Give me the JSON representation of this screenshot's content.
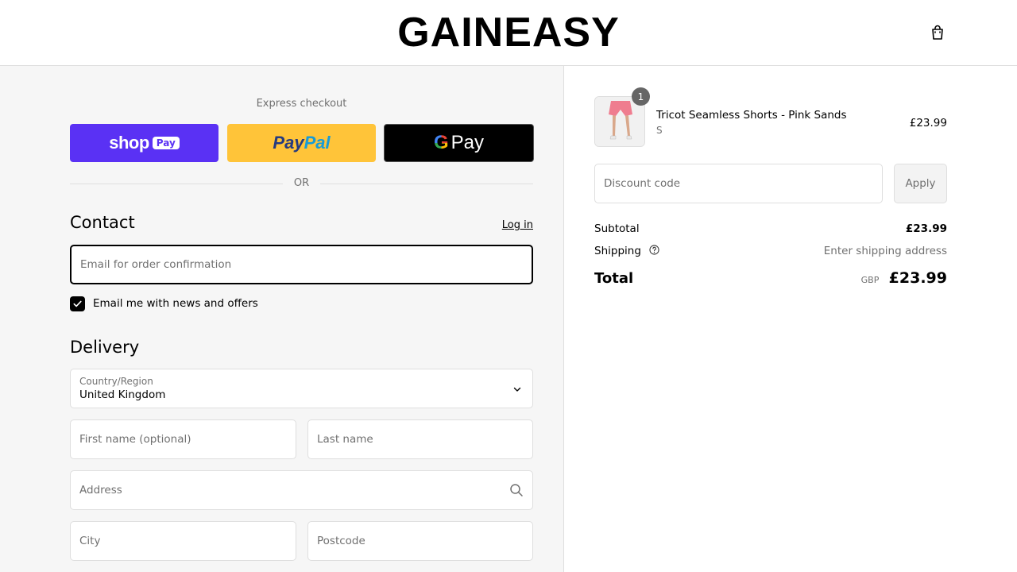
{
  "header": {
    "brand": "GAINEASY",
    "cart_icon": "shopping-bag-icon"
  },
  "express": {
    "label": "Express checkout",
    "shop_pay": {
      "word": "shop",
      "badge": "Pay"
    },
    "paypal": {
      "part1": "Pay",
      "part2": "Pal"
    },
    "gpay": {
      "g": "G",
      "word": "Pay"
    },
    "or": "OR"
  },
  "contact": {
    "title": "Contact",
    "login": "Log in",
    "email_placeholder": "Email for order confirmation",
    "newsletter_label": "Email me with news and offers",
    "newsletter_checked": true
  },
  "delivery": {
    "title": "Delivery",
    "country_label": "Country/Region",
    "country_value": "United Kingdom",
    "first_name_placeholder": "First name (optional)",
    "last_name_placeholder": "Last name",
    "address_placeholder": "Address",
    "city_placeholder": "City",
    "postcode_placeholder": "Postcode"
  },
  "order": {
    "item": {
      "name": "Tricot Seamless Shorts - Pink Sands",
      "variant": "S",
      "price": "£23.99",
      "quantity": "1"
    },
    "discount_placeholder": "Discount code",
    "apply": "Apply",
    "subtotal_label": "Subtotal",
    "subtotal_value": "£23.99",
    "shipping_label": "Shipping",
    "shipping_value": "Enter shipping address",
    "total_label": "Total",
    "currency": "GBP",
    "total_value": "£23.99"
  },
  "colors": {
    "shop_pay": "#5a31f4",
    "paypal": "#ffc439",
    "gpay": "#000000",
    "panel_bg": "#f6f6f6"
  }
}
